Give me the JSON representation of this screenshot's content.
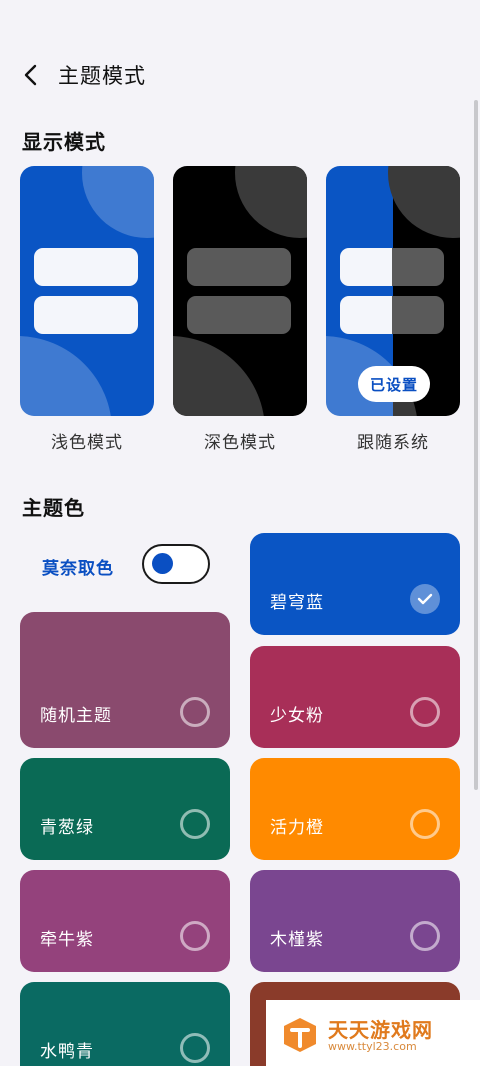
{
  "header": {
    "title": "主题模式"
  },
  "display_mode": {
    "section_title": "显示模式",
    "options": [
      {
        "label": "浅色模式"
      },
      {
        "label": "深色模式"
      },
      {
        "label": "跟随系统",
        "badge": "已设置"
      }
    ]
  },
  "theme_color": {
    "section_title": "主题色",
    "monet_label": "莫奈取色",
    "monet_enabled": true,
    "themes": [
      {
        "name": "碧穹蓝",
        "color": "#0a55c4",
        "selected": true
      },
      {
        "name": "随机主题",
        "color": "#8a4a6e",
        "selected": false
      },
      {
        "name": "少女粉",
        "color": "#a82f58",
        "selected": false
      },
      {
        "name": "青葱绿",
        "color": "#0a6a55",
        "selected": false
      },
      {
        "name": "活力橙",
        "color": "#ff8a00",
        "selected": false
      },
      {
        "name": "牵牛紫",
        "color": "#94427c",
        "selected": false
      },
      {
        "name": "木槿紫",
        "color": "#7a4690",
        "selected": false
      },
      {
        "name": "水鸭青",
        "color": "#0a6a62",
        "selected": false
      }
    ]
  },
  "watermark": {
    "title": "天天游戏网",
    "url": "www.ttyl23.com"
  }
}
